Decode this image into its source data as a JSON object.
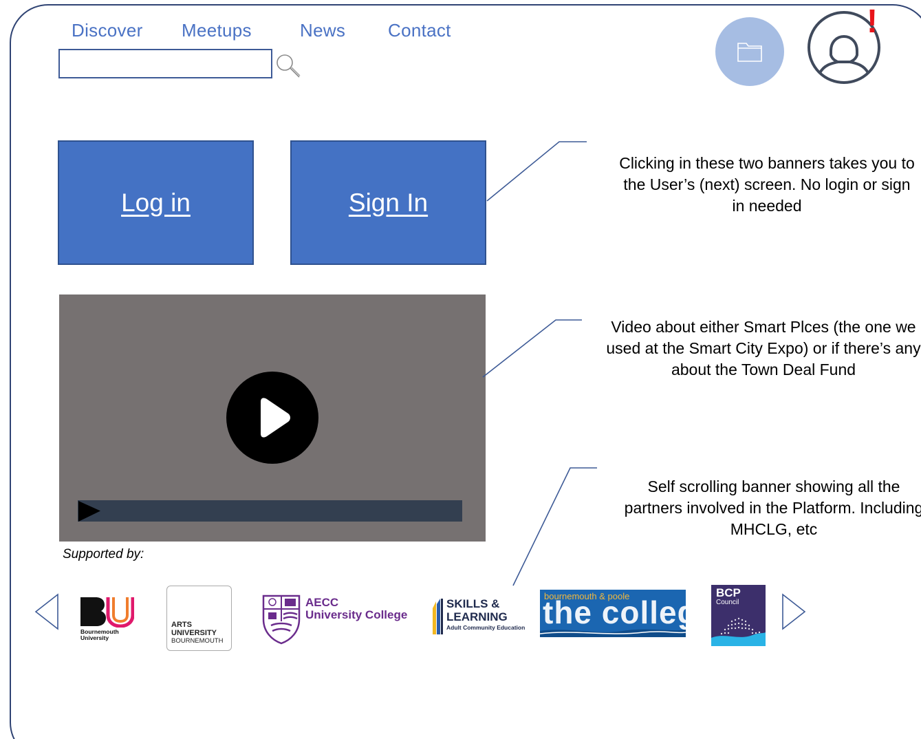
{
  "nav": {
    "items": [
      {
        "label": "Discover"
      },
      {
        "label": "Meetups"
      },
      {
        "label": "News"
      },
      {
        "label": "Contact"
      }
    ]
  },
  "search": {
    "value": "",
    "placeholder": ""
  },
  "header": {
    "alert_mark": "!"
  },
  "banners": {
    "login_label": "Log in",
    "signin_label": "Sign In"
  },
  "notes": {
    "banner_note": "Clicking in these two banners takes you to the User’s (next) screen. No login or sign in needed",
    "video_note": "Video about either Smart Plces (the one we used at the Smart City Expo) or if there’s any about the Town Deal Fund",
    "partners_note": "Self scrolling banner showing all the partners involved in the Platform. Including MHCLG, etc"
  },
  "partners": {
    "heading": "Supported by:",
    "bu": {
      "letters": "BU",
      "caption_line1": "Bournemouth",
      "caption_line2": "University"
    },
    "arts": {
      "line1": "ARTS",
      "line2": "UNIVERSITY",
      "line3": "BOURNEMOUTH"
    },
    "aecc": {
      "line1": "AECC",
      "line2": "University College"
    },
    "skills": {
      "line1": "SKILLS &",
      "line2": "LEARNING",
      "line3": "Adult Community Education"
    },
    "college": {
      "top": "bournemouth & poole",
      "main": "the college"
    },
    "bcp": {
      "title": "BCP",
      "sub": "Council"
    }
  },
  "icons": {
    "search": "magnifier-icon",
    "folder": "folder-icon",
    "avatar": "user-avatar-icon",
    "play": "play-icon",
    "prev": "chevron-left-icon",
    "next": "chevron-right-icon"
  },
  "colors": {
    "nav_text": "#4a72c4",
    "banner_fill": "#4472c4",
    "video_bg": "#767171",
    "progress_bg": "#333f50",
    "folder_circle": "#a6bde3",
    "alert": "#e8141a"
  }
}
